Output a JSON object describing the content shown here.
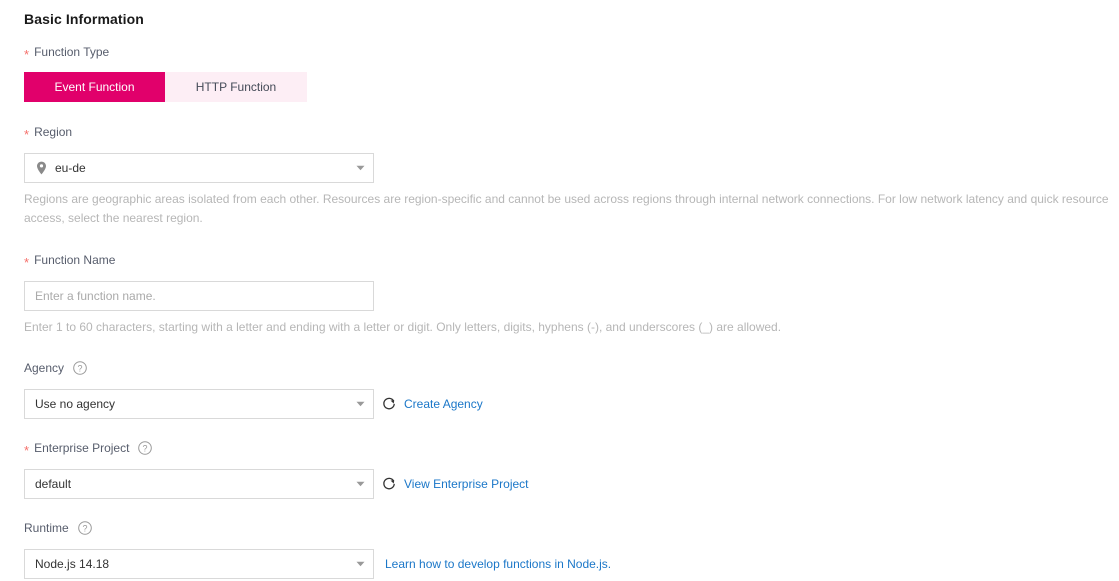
{
  "section": {
    "title": "Basic Information"
  },
  "function_type": {
    "label": "Function Type",
    "required_mark": "*",
    "options": [
      {
        "label": "Event Function",
        "selected": true
      },
      {
        "label": "HTTP Function",
        "selected": false
      }
    ],
    "active_color": "#e1006b",
    "inactive_color": "#fdeef5"
  },
  "region": {
    "label": "Region",
    "required_mark": "*",
    "value": "eu-de",
    "icon": "location-pin-icon",
    "caret": "chevron-down-icon",
    "hint": "Regions are geographic areas isolated from each other. Resources are region-specific and cannot be used across regions through internal network connections. For low network latency and quick resource access, select the nearest region."
  },
  "function_name": {
    "label": "Function Name",
    "required_mark": "*",
    "value": "",
    "placeholder": "Enter a function name.",
    "hint": "Enter 1 to 60 characters, starting with a letter and ending with a letter or digit. Only letters, digits, hyphens (-), and underscores (_) are allowed."
  },
  "agency": {
    "label": "Agency",
    "required_mark": "",
    "help_icon": "question-circle-icon",
    "value": "Use no agency",
    "caret": "chevron-down-icon",
    "refresh_icon": "refresh-icon",
    "link": "Create Agency"
  },
  "enterprise_project": {
    "label": "Enterprise Project",
    "required_mark": "*",
    "help_icon": "question-circle-icon",
    "value": "default",
    "caret": "chevron-down-icon",
    "refresh_icon": "refresh-icon",
    "link": "View Enterprise Project"
  },
  "runtime": {
    "label": "Runtime",
    "required_mark": "",
    "help_icon": "question-circle-icon",
    "value": "Node.js 14.18",
    "caret": "chevron-down-icon",
    "link": "Learn how to develop functions in Node.js."
  },
  "colors": {
    "accent": "#e1006b",
    "link": "#1b77c8",
    "required": "#f66f6a",
    "label": "#575d6c",
    "hint": "#b6b6b6",
    "border": "#d9d9d9"
  }
}
